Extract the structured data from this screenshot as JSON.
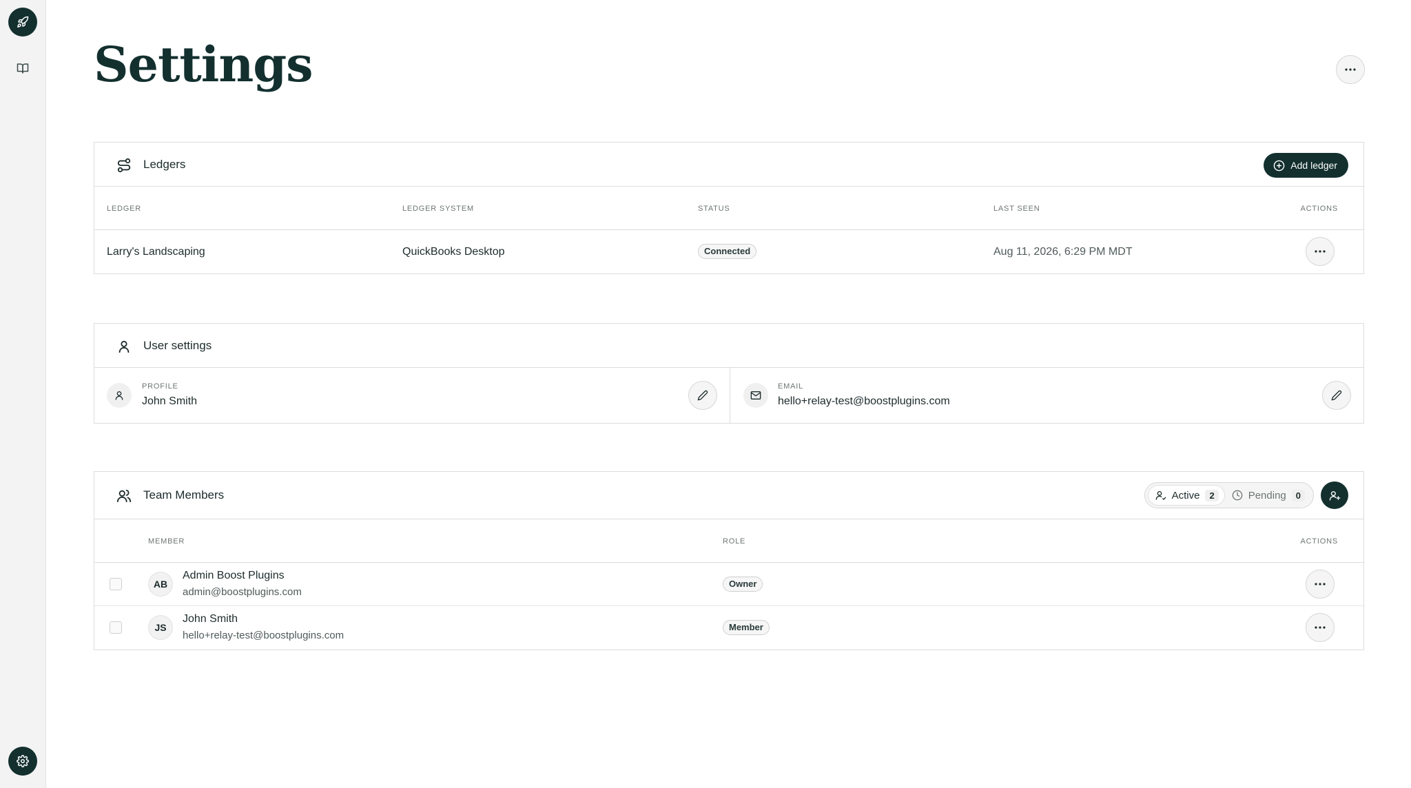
{
  "page": {
    "title": "Settings"
  },
  "sidebar": {
    "items": [
      {
        "icon": "rocket-icon"
      },
      {
        "icon": "book-icon"
      },
      {
        "icon": "gear-icon"
      }
    ]
  },
  "ledgers": {
    "title": "Ledgers",
    "add_label": "Add ledger",
    "columns": [
      "LEDGER",
      "LEDGER SYSTEM",
      "STATUS",
      "LAST SEEN",
      "ACTIONS"
    ],
    "rows": [
      {
        "ledger": "Larry's Landscaping",
        "system": "QuickBooks Desktop",
        "status": "Connected",
        "last_seen": "Aug 11, 2026, 6:29 PM MDT"
      }
    ]
  },
  "user_settings": {
    "title": "User settings",
    "profile_label": "PROFILE",
    "profile_value": "John Smith",
    "email_label": "EMAIL",
    "email_value": "hello+relay-test@boostplugins.com"
  },
  "team": {
    "title": "Team Members",
    "active_label": "Active",
    "active_count": "2",
    "pending_label": "Pending",
    "pending_count": "0",
    "columns": [
      "MEMBER",
      "ROLE",
      "ACTIONS"
    ],
    "members": [
      {
        "initials": "AB",
        "name": "Admin Boost Plugins",
        "email": "admin@boostplugins.com",
        "role": "Owner"
      },
      {
        "initials": "JS",
        "name": "John Smith",
        "email": "hello+relay-test@boostplugins.com",
        "role": "Member"
      }
    ]
  },
  "colors": {
    "brand_dark": "#13302f",
    "border": "#dcdcdc"
  }
}
